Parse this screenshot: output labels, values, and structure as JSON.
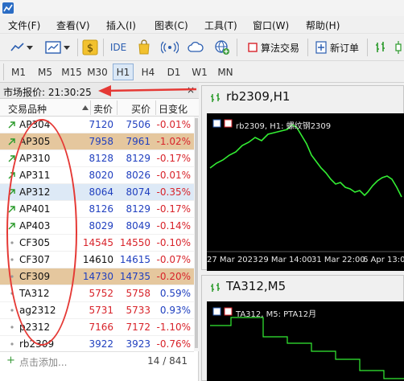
{
  "menu": [
    "文件(F)",
    "查看(V)",
    "插入(I)",
    "图表(C)",
    "工具(T)",
    "窗口(W)",
    "帮助(H)"
  ],
  "toolbar": {
    "ide_label": "IDE",
    "algo_label": "算法交易",
    "new_order_label": "新订单"
  },
  "timeframes": [
    "M1",
    "M5",
    "M15",
    "M30",
    "H1",
    "H4",
    "D1",
    "W1",
    "MN"
  ],
  "timeframe_active": "H1",
  "market_watch": {
    "title": "市场报价: 21:30:25",
    "close": "×",
    "headers": {
      "symbol": "交易品种",
      "bid": "卖价",
      "ask": "买价",
      "change": "日变化"
    },
    "rows": [
      {
        "symbol": "AP304",
        "bid": "7120",
        "ask": "7506",
        "change": "-0.01%"
      },
      {
        "symbol": "AP305",
        "bid": "7958",
        "ask": "7961",
        "change": "-1.02%"
      },
      {
        "symbol": "AP310",
        "bid": "8128",
        "ask": "8129",
        "change": "-0.17%"
      },
      {
        "symbol": "AP311",
        "bid": "8020",
        "ask": "8026",
        "change": "-0.01%"
      },
      {
        "symbol": "AP312",
        "bid": "8064",
        "ask": "8074",
        "change": "-0.35%"
      },
      {
        "symbol": "AP401",
        "bid": "8126",
        "ask": "8129",
        "change": "-0.17%"
      },
      {
        "symbol": "AP403",
        "bid": "8029",
        "ask": "8049",
        "change": "-0.14%"
      },
      {
        "symbol": "CF305",
        "bid": "14545",
        "ask": "14550",
        "change": "-0.10%"
      },
      {
        "symbol": "CF307",
        "bid": "14610",
        "ask": "14615",
        "change": "-0.07%"
      },
      {
        "symbol": "CF309",
        "bid": "14730",
        "ask": "14735",
        "change": "-0.20%"
      },
      {
        "symbol": "TA312",
        "bid": "5752",
        "ask": "5758",
        "change": "0.59%"
      },
      {
        "symbol": "ag2312",
        "bid": "5731",
        "ask": "5733",
        "change": "0.93%"
      },
      {
        "symbol": "p2312",
        "bid": "7166",
        "ask": "7172",
        "change": "-1.10%"
      },
      {
        "symbol": "rb2309",
        "bid": "3922",
        "ask": "3923",
        "change": "-0.76%"
      }
    ],
    "add_label": "点击添加...",
    "count": "14 / 841"
  },
  "chart1": {
    "title": "rb2309,H1",
    "inner_label": "rb2309, H1: 螺纹钢2309",
    "dates": [
      "27 Mar 2023",
      "29 Mar 14:00",
      "31 Mar 22:00",
      "6 Apr 13:00"
    ]
  },
  "chart2": {
    "title": "TA312,M5",
    "inner_label": "TA312, M5: PTA12月"
  },
  "colors": {
    "accent": "#1f3fbf",
    "negative": "#d8232a",
    "highlight": "#e5c79e",
    "annotation": "#e53935"
  }
}
